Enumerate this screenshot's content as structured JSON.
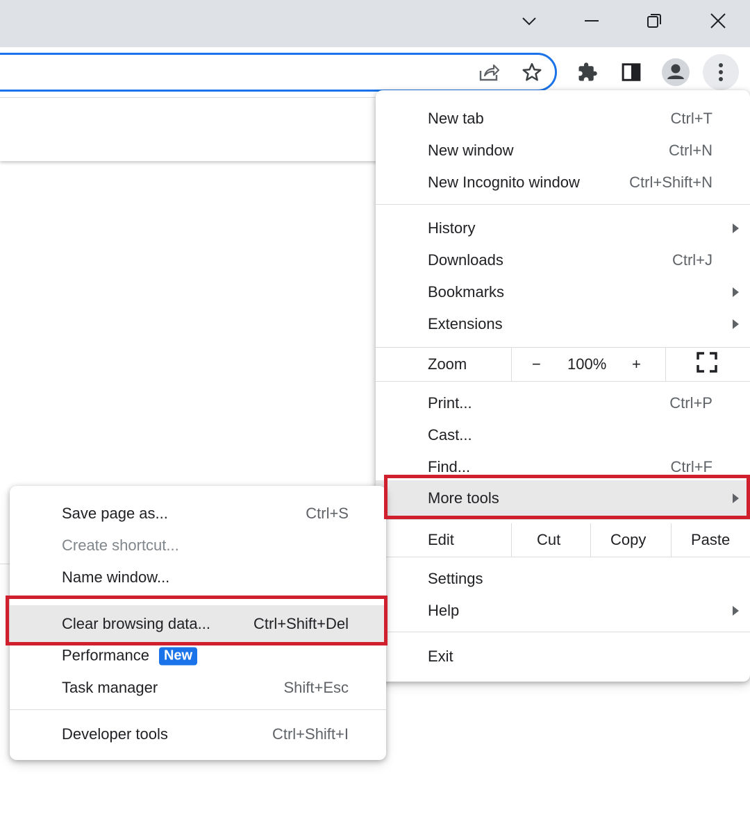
{
  "window_controls": {
    "tab_search": "chevron-down-icon",
    "minimize": "minimize-icon",
    "restore": "restore-icon",
    "close": "close-icon"
  },
  "toolbar": {
    "icons": [
      "share-icon",
      "bookmark-star-icon",
      "extensions-puzzle-icon",
      "side-panel-icon",
      "profile-avatar-icon",
      "kebab-menu-icon"
    ]
  },
  "main_menu": {
    "new_tab": {
      "label": "New tab",
      "shortcut": "Ctrl+T"
    },
    "new_window": {
      "label": "New window",
      "shortcut": "Ctrl+N"
    },
    "new_incognito": {
      "label": "New Incognito window",
      "shortcut": "Ctrl+Shift+N"
    },
    "history": {
      "label": "History"
    },
    "downloads": {
      "label": "Downloads",
      "shortcut": "Ctrl+J"
    },
    "bookmarks": {
      "label": "Bookmarks"
    },
    "extensions": {
      "label": "Extensions"
    },
    "zoom": {
      "label": "Zoom",
      "minus": "−",
      "value": "100%",
      "plus": "+"
    },
    "print": {
      "label": "Print...",
      "shortcut": "Ctrl+P"
    },
    "cast": {
      "label": "Cast..."
    },
    "find": {
      "label": "Find...",
      "shortcut": "Ctrl+F"
    },
    "more_tools": {
      "label": "More tools"
    },
    "edit": {
      "label": "Edit",
      "cut": "Cut",
      "copy": "Copy",
      "paste": "Paste"
    },
    "settings": {
      "label": "Settings"
    },
    "help": {
      "label": "Help"
    },
    "exit": {
      "label": "Exit"
    }
  },
  "sub_menu": {
    "save_page": {
      "label": "Save page as...",
      "shortcut": "Ctrl+S"
    },
    "create_shortcut": {
      "label": "Create shortcut..."
    },
    "name_window": {
      "label": "Name window..."
    },
    "clear_browsing": {
      "label": "Clear browsing data...",
      "shortcut": "Ctrl+Shift+Del"
    },
    "performance": {
      "label": "Performance",
      "badge": "New"
    },
    "task_manager": {
      "label": "Task manager",
      "shortcut": "Shift+Esc"
    },
    "developer_tools": {
      "label": "Developer tools",
      "shortcut": "Ctrl+Shift+I"
    }
  },
  "colors": {
    "highlight_box": "#d0202e",
    "accent": "#1a73e8",
    "hover_bg": "#e8e8e9"
  }
}
